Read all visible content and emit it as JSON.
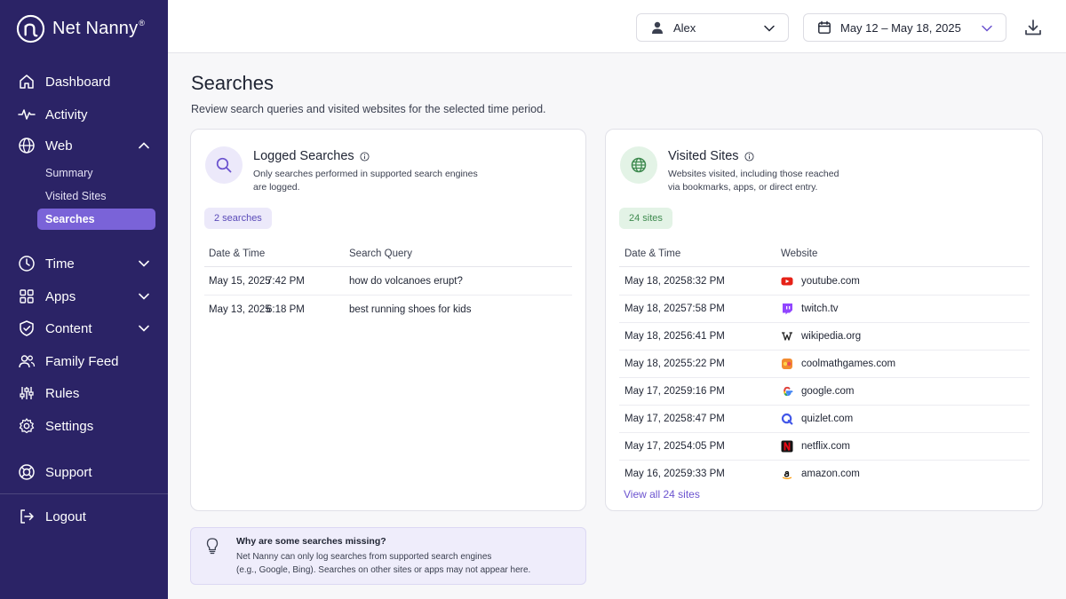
{
  "brand": {
    "name": "Net Nanny",
    "reg": "®"
  },
  "sidebar": {
    "items": [
      {
        "label": "Dashboard"
      },
      {
        "label": "Activity"
      },
      {
        "label": "Web"
      },
      {
        "label": "Time"
      },
      {
        "label": "Apps"
      },
      {
        "label": "Content"
      },
      {
        "label": "Family Feed"
      },
      {
        "label": "Rules"
      },
      {
        "label": "Settings"
      },
      {
        "label": "Support"
      },
      {
        "label": "Logout"
      }
    ],
    "web_sub": [
      {
        "label": "Summary"
      },
      {
        "label": "Visited Sites"
      },
      {
        "label": "Searches"
      }
    ],
    "active_sub": "Searches"
  },
  "topbar": {
    "profile": "Alex",
    "date_range": "May 12 – May 18, 2025"
  },
  "page": {
    "title": "Searches",
    "subtitle": "Review search queries and visited websites for the selected time period."
  },
  "searches": {
    "title": "Logged Searches",
    "desc_line1": "Only searches performed in supported search engines",
    "desc_line2": "are logged.",
    "count": "2 searches",
    "col_date": "Date & Time",
    "col_query": "Search Query",
    "rows": [
      {
        "date": "May 15, 2025",
        "time": "7:42 PM",
        "query": "how do volcanoes erupt?"
      },
      {
        "date": "May 13, 2025",
        "time": "6:18 PM",
        "query": "best running shoes for kids"
      }
    ]
  },
  "visited": {
    "title": "Visited Sites",
    "desc_line1": "Websites visited, including those reached",
    "desc_line2": "via bookmarks, apps, or direct entry.",
    "count": "24 sites",
    "col_date": "Date & Time",
    "col_site": "Website",
    "rows": [
      {
        "date": "May 18, 2025",
        "time": "8:32 PM",
        "site": "youtube.com",
        "icon": "youtube-icon"
      },
      {
        "date": "May 18, 2025",
        "time": "7:58 PM",
        "site": "twitch.tv",
        "icon": "twitch-icon"
      },
      {
        "date": "May 18, 2025",
        "time": "6:41 PM",
        "site": "wikipedia.org",
        "icon": "wikipedia-icon"
      },
      {
        "date": "May 18, 2025",
        "time": "5:22 PM",
        "site": "coolmathgames.com",
        "icon": "coolmathgames-icon"
      },
      {
        "date": "May 17, 2025",
        "time": "9:16 PM",
        "site": "google.com",
        "icon": "google-icon"
      },
      {
        "date": "May 17, 2025",
        "time": "8:47 PM",
        "site": "quizlet.com",
        "icon": "quizlet-icon"
      },
      {
        "date": "May 17, 2025",
        "time": "4:05 PM",
        "site": "netflix.com",
        "icon": "netflix-icon"
      },
      {
        "date": "May 16, 2025",
        "time": "9:33 PM",
        "site": "amazon.com",
        "icon": "amazon-icon"
      }
    ],
    "view_all": "View all 24 sites"
  },
  "note": {
    "title": "Why are some searches missing?",
    "line1": "Net Nanny can only log searches from supported search engines",
    "line2": "(e.g., Google, Bing). Searches on other sites or apps may not appear here."
  },
  "colors": {
    "sidebar_bg": "#2b2366",
    "accent": "#7a63d8",
    "link": "#6b53cf",
    "search_pill_bg": "#ece9fa",
    "sites_pill_bg": "#e3f3e6"
  }
}
